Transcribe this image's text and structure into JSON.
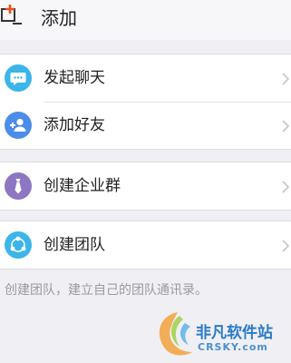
{
  "header": {
    "title": "添加",
    "back_icon": "add-window-icon"
  },
  "colors": {
    "chat_icon": "#3bb5ea",
    "friend_icon": "#4b8de8",
    "group_icon": "#8d76c2",
    "team_icon": "#3bb5ea",
    "chevron": "#c4c4c8"
  },
  "menu": {
    "start_chat": "发起聊天",
    "add_friend": "添加好友",
    "create_group": "创建企业群",
    "create_team": "创建团队"
  },
  "footnote": "创建团队，建立自己的团队通讯录。",
  "watermark": {
    "cn": "非凡软件站",
    "en": "CRSKY.com"
  }
}
